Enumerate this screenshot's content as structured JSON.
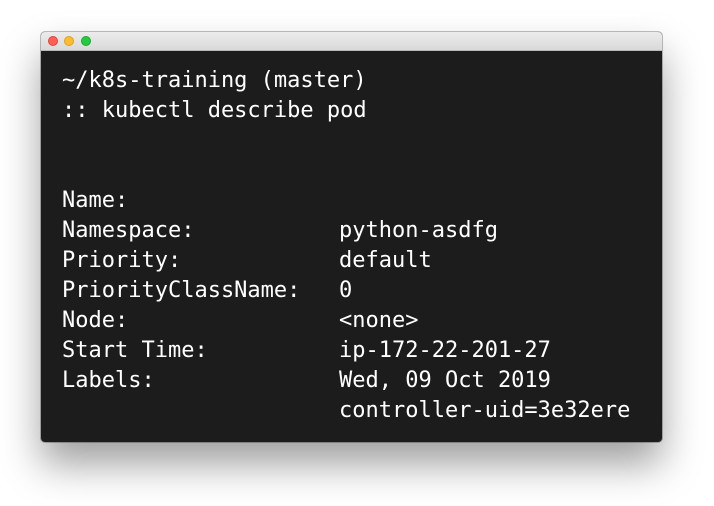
{
  "terminal": {
    "prompt_path": "~/k8s-training (master)",
    "command_line": ":: kubectl describe pod",
    "fields": [
      {
        "key": "Name:",
        "value": "python-asdfg"
      },
      {
        "key": "Namespace:",
        "value": "default"
      },
      {
        "key": "Priority:",
        "value": "0"
      },
      {
        "key": "PriorityClassName:",
        "value": "<none>"
      },
      {
        "key": "Node:",
        "value": "ip-172-22-201-27"
      },
      {
        "key": "Start Time:",
        "value": "Wed, 09 Oct 2019"
      },
      {
        "key": "Labels:",
        "value": "controller-uid=3e32ere"
      }
    ]
  },
  "colors": {
    "background": "#1c1c1c",
    "text": "#ffffff",
    "close_light": "#fe5f57",
    "minimize_light": "#febc2e",
    "maximize_light": "#28c840"
  },
  "icons": [
    "close-icon",
    "minimize-icon",
    "maximize-icon"
  ]
}
